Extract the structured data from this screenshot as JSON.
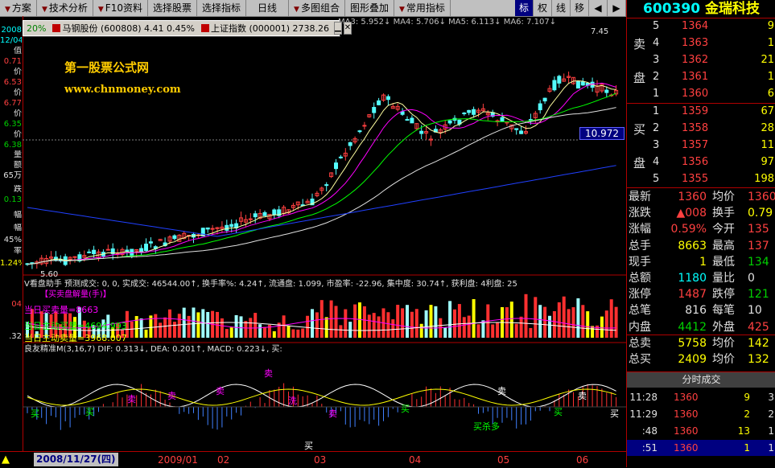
{
  "menu": {
    "items": [
      "方案",
      "技术分析",
      "F10资料",
      "选择股票",
      "选择指标",
      "日线",
      "多图组合",
      "图形叠加",
      "常用指标"
    ],
    "tools": [
      "标",
      "权",
      "线",
      "移",
      "◀",
      "▶"
    ]
  },
  "ticker": {
    "item1": "马钢股份 (600808) 4.41 0.45%",
    "item2": "上证指数 (000001) 2738.26",
    "prefix": "20%"
  },
  "watermark": {
    "title": "第一股票公式网",
    "url": "www.chnmoney.com"
  },
  "left_strip": {
    "items": [
      "2008",
      "12/04",
      "值",
      "0.71",
      "价",
      "6.53",
      "价",
      "6.77",
      "价",
      "6.35",
      "价",
      "6.38",
      "量",
      "额",
      "65万",
      "跌",
      "0.13",
      "幅",
      "幅",
      "45%",
      "率",
      "1.24%",
      "04",
      ".32"
    ]
  },
  "main_chart": {
    "ma_legend": "MA3: 5.952↓  MA4: 5.706↓  MA5: 6.113↓  MA6: 7.107↓",
    "price_label": "10.972",
    "low_label": "5.60",
    "high_label": "7.45"
  },
  "vol_panel": {
    "header": "V看盘助手  预测成交: 0, 0, 实成交: 46544.00↑, 换手率%: 4.24↑, 流通盘: 1.099, 市盈率: -22.96, 集中度: 30.74↑, 获利盘: 4利盘: 25",
    "title": "【买卖盘解量(手)】",
    "line1": "当日买卖量=8663",
    "line2": "当日主动买量=4694.993",
    "line3": "当日主动卖量=3968.007"
  },
  "macd_panel": {
    "header": "良友精准M(3,16,7)  DIF: 0.313↓, DEA: 0.201↑, MACD: 0.223↓, 买:",
    "axis_top": ".04",
    "axis_bottom": ".32"
  },
  "bottom": {
    "date_box": "2008/11/27(四)",
    "ticks": [
      "2009/01",
      "02",
      "03",
      "04",
      "05",
      "06"
    ]
  },
  "right_panel": {
    "code": "600390",
    "name": "金瑞科技",
    "sell_label_1": "卖",
    "sell_label_2": "盘",
    "buy_label_1": "买",
    "buy_label_2": "盘",
    "asks": [
      {
        "level": "5",
        "price": "1364",
        "qty": "9"
      },
      {
        "level": "4",
        "price": "1363",
        "qty": "1"
      },
      {
        "level": "3",
        "price": "1362",
        "qty": "21"
      },
      {
        "level": "2",
        "price": "1361",
        "qty": "1"
      },
      {
        "level": "1",
        "price": "1360",
        "qty": "6"
      }
    ],
    "bids": [
      {
        "level": "1",
        "price": "1359",
        "qty": "67"
      },
      {
        "level": "2",
        "price": "1358",
        "qty": "28"
      },
      {
        "level": "3",
        "price": "1357",
        "qty": "11"
      },
      {
        "level": "4",
        "price": "1356",
        "qty": "97"
      },
      {
        "level": "5",
        "price": "1355",
        "qty": "198"
      }
    ],
    "quotes": [
      {
        "l1": "最新",
        "v1": "1360",
        "l2": "均价",
        "v2": "1360"
      },
      {
        "l1": "涨跌",
        "v1": "▲008",
        "l2": "换手",
        "v2": "0.79"
      },
      {
        "l1": "涨幅",
        "v1": "0.59%",
        "l2": "今开",
        "v2": "135"
      },
      {
        "l1": "总手",
        "v1": "8663",
        "l2": "最高",
        "v2": "137"
      },
      {
        "l1": "现手",
        "v1": "1",
        "l2": "最低",
        "v2": "134"
      },
      {
        "l1": "总额",
        "v1": "1180",
        "l2": "量比",
        "v2": "0"
      },
      {
        "l1": "涨停",
        "v1": "1487",
        "l2": "跌停",
        "v2": "121"
      },
      {
        "l1": "总笔",
        "v1": "816",
        "l2": "每笔",
        "v2": "10"
      },
      {
        "l1": "内盘",
        "v1": "4412",
        "l2": "外盘",
        "v2": "425"
      },
      {
        "l1": "总卖",
        "v1": "5758",
        "l2": "均价",
        "v2": "142"
      },
      {
        "l1": "总买",
        "v1": "2409",
        "l2": "均价",
        "v2": "132"
      }
    ],
    "trades_title": "分时成交",
    "trades": [
      {
        "time": "11:28",
        "price": "1360",
        "vol": "9",
        "n": "3"
      },
      {
        "time": "11:29",
        "price": "1360",
        "vol": "2",
        "n": "2"
      },
      {
        "time": ":48",
        "price": "1360",
        "vol": "13",
        "n": "1"
      },
      {
        "time": ":51",
        "price": "1360",
        "vol": "1",
        "n": "1"
      }
    ]
  }
}
